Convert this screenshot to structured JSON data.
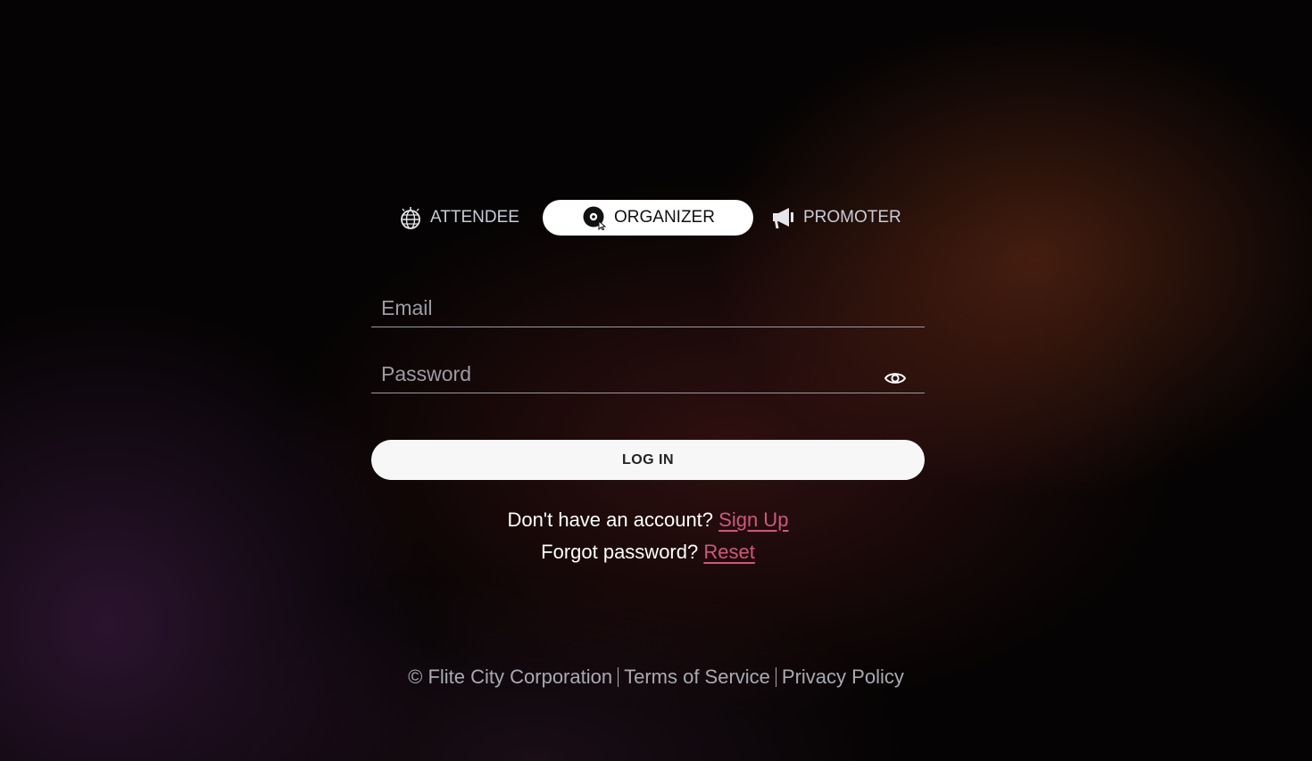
{
  "roles": {
    "attendee": {
      "label": "ATTENDEE",
      "icon": "disco-ball-icon"
    },
    "organizer": {
      "label": "ORGANIZER",
      "icon": "vinyl-record-icon",
      "selected": true
    },
    "promoter": {
      "label": "PROMOTER",
      "icon": "megaphone-icon"
    }
  },
  "form": {
    "email_placeholder": "Email",
    "email_value": "",
    "password_placeholder": "Password",
    "password_value": "",
    "login_label": "LOG IN"
  },
  "links": {
    "signup_prompt": "Don't have an account?",
    "signup_label": "Sign Up",
    "reset_prompt": "Forgot password?",
    "reset_label": "Reset"
  },
  "footer": {
    "copyright": "© Flite City Corporation",
    "terms": "Terms of Service",
    "privacy": "Privacy Policy"
  },
  "colors": {
    "accent_link": "#d0587c",
    "selected_tab_bg": "#ffffff"
  }
}
